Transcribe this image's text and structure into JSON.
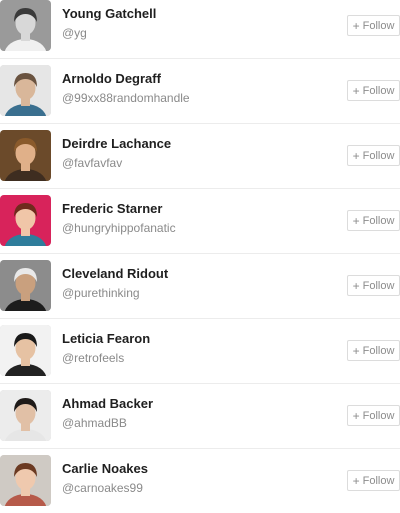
{
  "follow_label": "Follow",
  "follow_icon": "plus-icon",
  "users": [
    {
      "name": "Young Gatchell",
      "handle": "@yg",
      "bg": "#9a9a9a",
      "skin": "#d8d8d8",
      "hair": "#3a3a3a",
      "shirt": "#f0f0f0"
    },
    {
      "name": "Arnoldo Degraff",
      "handle": "@99xx88randomhandle",
      "bg": "#e6e6e6",
      "skin": "#d9b79a",
      "hair": "#6a5340",
      "shirt": "#3a6f8f"
    },
    {
      "name": "Deirdre Lachance",
      "handle": "@favfavfav",
      "bg": "#6b4a2a",
      "skin": "#e0b089",
      "hair": "#8a5a2b",
      "shirt": "#3e2d20"
    },
    {
      "name": "Frederic Starner",
      "handle": "@hungryhippofanatic",
      "bg": "#d8235b",
      "skin": "#f0c6a8",
      "hair": "#6f2b1d",
      "shirt": "#2f7d9b"
    },
    {
      "name": "Cleveland Ridout",
      "handle": "@purethinking",
      "bg": "#8c8c8c",
      "skin": "#c9a07e",
      "hair": "#e9e9e9",
      "shirt": "#1c1c1c"
    },
    {
      "name": "Leticia Fearon",
      "handle": "@retrofeels",
      "bg": "#f2f2f2",
      "skin": "#e6c2a3",
      "hair": "#1a1a1a",
      "shirt": "#222222"
    },
    {
      "name": "Ahmad Backer",
      "handle": "@ahmadBB",
      "bg": "#ececec",
      "skin": "#e1c0a6",
      "hair": "#1e1a18",
      "shirt": "#e6e6e6"
    },
    {
      "name": "Carlie Noakes",
      "handle": "@carnoakes99",
      "bg": "#cfcac4",
      "skin": "#efc9ae",
      "hair": "#6b3a22",
      "shirt": "#b65a4a"
    }
  ]
}
